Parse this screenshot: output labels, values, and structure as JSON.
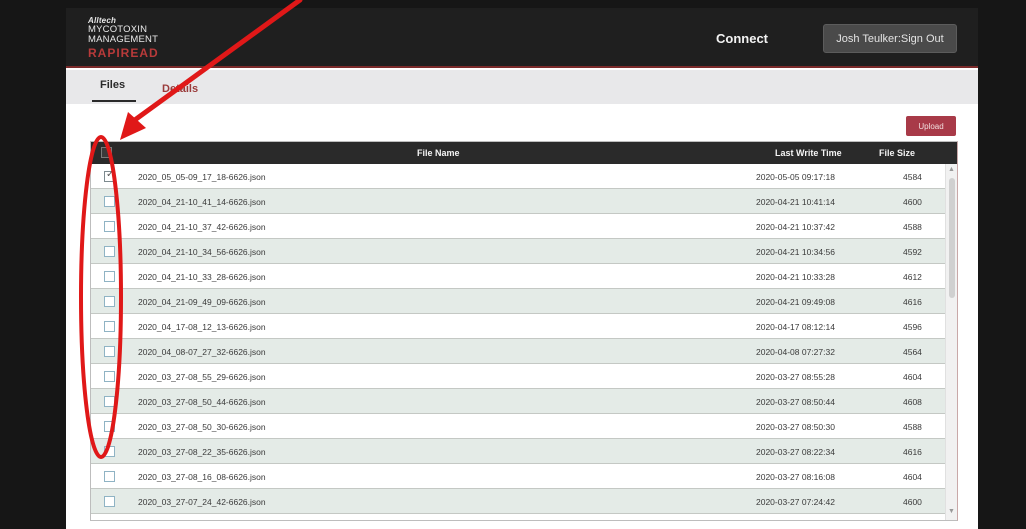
{
  "header": {
    "brand": "Alltech",
    "logo_line1": "MYCOTOXIN",
    "logo_line2": "MANAGEMENT",
    "product": "RAPIREAD",
    "connect_label": "Connect",
    "signout_label": "Josh Teulker:Sign Out"
  },
  "tabs": {
    "files": "Files",
    "details": "Details"
  },
  "upload_label": "Upload",
  "table": {
    "columns": {
      "name": "File Name",
      "time": "Last Write Time",
      "size": "File Size"
    },
    "rows": [
      {
        "name": "2020_05_05-09_17_18-6626.json",
        "time": "2020-05-05 09:17:18",
        "size": "4584",
        "checked": true
      },
      {
        "name": "2020_04_21-10_41_14-6626.json",
        "time": "2020-04-21 10:41:14",
        "size": "4600",
        "checked": false
      },
      {
        "name": "2020_04_21-10_37_42-6626.json",
        "time": "2020-04-21 10:37:42",
        "size": "4588",
        "checked": false
      },
      {
        "name": "2020_04_21-10_34_56-6626.json",
        "time": "2020-04-21 10:34:56",
        "size": "4592",
        "checked": false
      },
      {
        "name": "2020_04_21-10_33_28-6626.json",
        "time": "2020-04-21 10:33:28",
        "size": "4612",
        "checked": false
      },
      {
        "name": "2020_04_21-09_49_09-6626.json",
        "time": "2020-04-21 09:49:08",
        "size": "4616",
        "checked": false
      },
      {
        "name": "2020_04_17-08_12_13-6626.json",
        "time": "2020-04-17 08:12:14",
        "size": "4596",
        "checked": false
      },
      {
        "name": "2020_04_08-07_27_32-6626.json",
        "time": "2020-04-08 07:27:32",
        "size": "4564",
        "checked": false
      },
      {
        "name": "2020_03_27-08_55_29-6626.json",
        "time": "2020-03-27 08:55:28",
        "size": "4604",
        "checked": false
      },
      {
        "name": "2020_03_27-08_50_44-6626.json",
        "time": "2020-03-27 08:50:44",
        "size": "4608",
        "checked": false
      },
      {
        "name": "2020_03_27-08_50_30-6626.json",
        "time": "2020-03-27 08:50:30",
        "size": "4588",
        "checked": false
      },
      {
        "name": "2020_03_27-08_22_35-6626.json",
        "time": "2020-03-27 08:22:34",
        "size": "4616",
        "checked": false
      },
      {
        "name": "2020_03_27-08_16_08-6626.json",
        "time": "2020-03-27 08:16:08",
        "size": "4604",
        "checked": false
      },
      {
        "name": "2020_03_27-07_24_42-6626.json",
        "time": "2020-03-27 07:24:42",
        "size": "4600",
        "checked": false
      }
    ]
  },
  "colors": {
    "header_bg": "#1f1f1f",
    "accent_red": "#a83a48",
    "annotation_red": "#e01818",
    "row_alt": "#e4ebe7"
  }
}
